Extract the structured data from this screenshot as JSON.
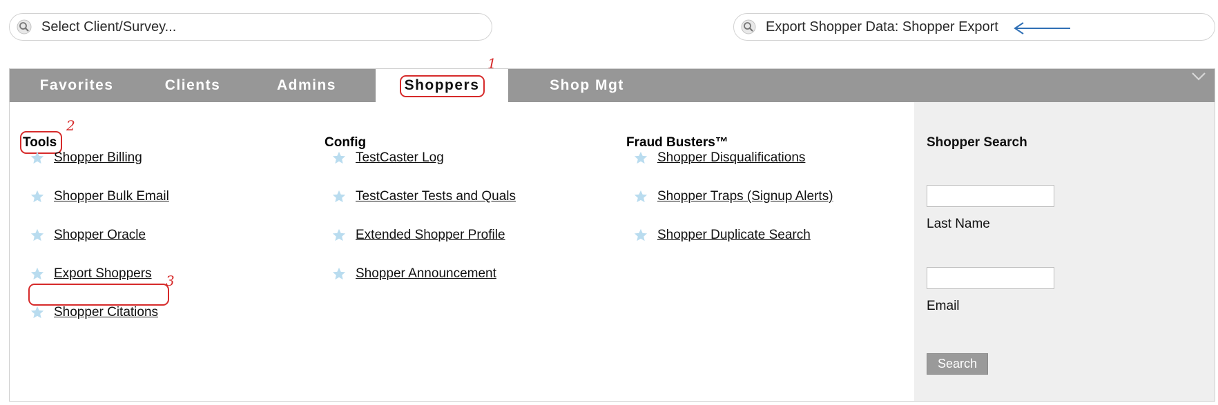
{
  "top_search": {
    "left_placeholder": "Select Client/Survey...",
    "right_value": "Export Shopper Data: Shopper Export",
    "search_icon": "search-icon"
  },
  "tabs": [
    {
      "label": "Favorites",
      "active": false
    },
    {
      "label": "Clients",
      "active": false
    },
    {
      "label": "Admins",
      "active": false
    },
    {
      "label": "Shoppers",
      "active": true
    },
    {
      "label": "Shop Mgt",
      "active": false
    }
  ],
  "annotations": {
    "step1": "1",
    "step2": "2",
    "step3": "3",
    "color": "#d62a2a"
  },
  "columns": {
    "tools": {
      "heading": "Tools",
      "items": [
        "Shopper Billing",
        "Shopper Bulk Email",
        "Shopper Oracle",
        "Export Shoppers",
        "Shopper Citations"
      ]
    },
    "config": {
      "heading": "Config",
      "items": [
        "TestCaster Log",
        "TestCaster Tests and Quals",
        "Extended Shopper Profile",
        "Shopper Announcement"
      ]
    },
    "fraud": {
      "heading": "Fraud Busters™",
      "items": [
        "Shopper Disqualifications",
        "Shopper Traps (Signup Alerts)",
        "Shopper Duplicate Search"
      ]
    }
  },
  "shopper_search": {
    "title": "Shopper Search",
    "last_name_label": "Last Name",
    "email_label": "Email",
    "button_label": "Search"
  },
  "colors": {
    "tabbar": "#979797",
    "side_panel": "#efefef",
    "star": "#b9dcef",
    "arrow": "#2f6fb5"
  }
}
